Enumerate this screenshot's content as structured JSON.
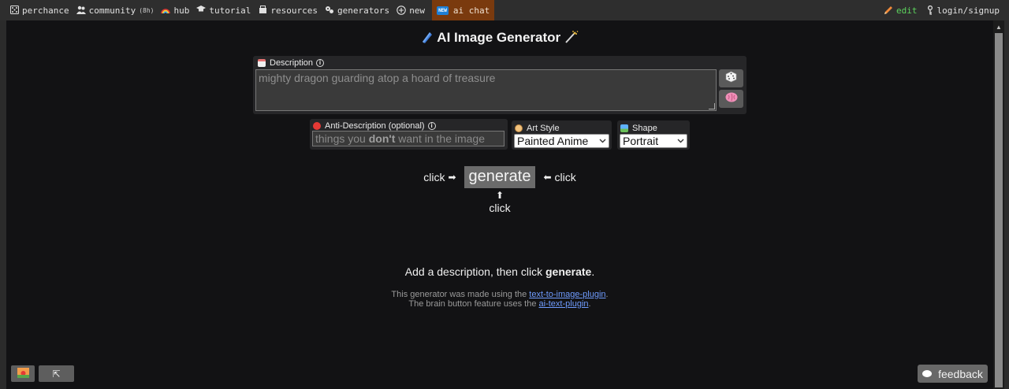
{
  "nav": {
    "items": [
      {
        "label": "perchance",
        "icon": "dice-icon"
      },
      {
        "label": "community",
        "sub": "(8h)",
        "icon": "people-icon"
      },
      {
        "label": "hub",
        "icon": "rainbow-icon"
      },
      {
        "label": "tutorial",
        "icon": "graduation-icon"
      },
      {
        "label": "resources",
        "icon": "box-icon"
      },
      {
        "label": "generators",
        "icon": "gears-icon"
      },
      {
        "label": "new",
        "icon": "plus-circle-icon"
      }
    ],
    "ai_chat": {
      "badge": "NEW",
      "label": "ai chat"
    },
    "edit_label": "edit",
    "login_label": "login/signup"
  },
  "page": {
    "title": "AI Image Generator",
    "description": {
      "label": "Description",
      "placeholder": "mighty dragon guarding atop a hoard of treasure"
    },
    "anti_description": {
      "label": "Anti-Description (optional)",
      "placeholder_before": "things you ",
      "placeholder_bold": "don't",
      "placeholder_after": " want in the image"
    },
    "art_style": {
      "label": "Art Style",
      "value": "Painted Anime"
    },
    "shape": {
      "label": "Shape",
      "value": "Portrait"
    },
    "generate": {
      "button": "generate",
      "click_left": "click",
      "click_right": "click",
      "click_below": "click"
    },
    "status": {
      "before": "Add a description, then click ",
      "bold": "generate",
      "after": "."
    },
    "credits": {
      "line1_before": "This generator was made using the ",
      "line1_link": "text-to-image-plugin",
      "line1_after": ".",
      "line2_before": "The brain button feature uses the ",
      "line2_link": "ai-text-plugin",
      "line2_after": "."
    },
    "feedback_label": "feedback"
  },
  "colors": {
    "frame_bg": "#121214",
    "topbar_bg": "#2e2e2e",
    "ai_chat_bg": "#7a3a0e",
    "edit_color": "#5dd35d",
    "link_color": "#6f9cff"
  }
}
